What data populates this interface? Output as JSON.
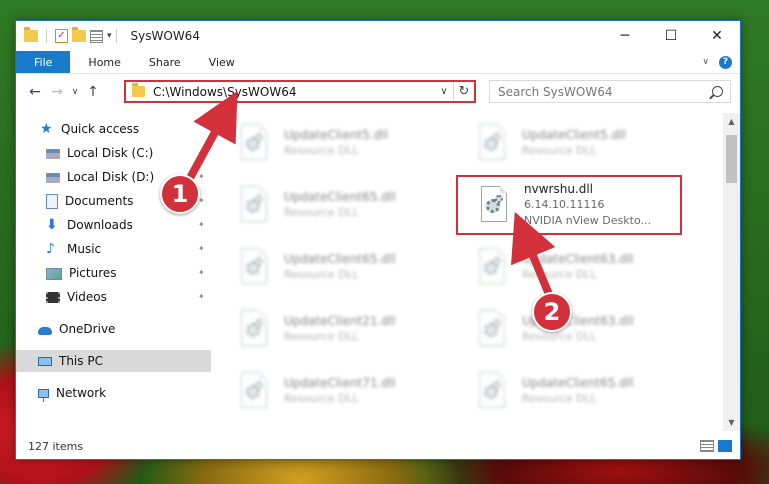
{
  "window": {
    "title": "SysWOW64",
    "minimize_glyph": "─",
    "maximize_glyph": "☐",
    "close_glyph": "✕",
    "qat_dropdown_glyph": "▾"
  },
  "ribbon": {
    "tabs": [
      {
        "label": "File"
      },
      {
        "label": "Home"
      },
      {
        "label": "Share"
      },
      {
        "label": "View"
      }
    ],
    "expand_glyph": "∨",
    "help_glyph": "?"
  },
  "navigation": {
    "back_glyph": "←",
    "forward_glyph": "→",
    "recent_glyph": "∨",
    "up_glyph": "↑"
  },
  "address": {
    "path": "C:\\Windows\\SysWOW64",
    "dropdown_glyph": "∨",
    "refresh_glyph": "↻"
  },
  "search": {
    "placeholder": "Search SysWOW64"
  },
  "sidebar": {
    "items": [
      {
        "label": "Quick access",
        "icon": "star-icon"
      },
      {
        "label": "Local Disk (C:)",
        "icon": "disk-icon",
        "pinned": true
      },
      {
        "label": "Local Disk (D:)",
        "icon": "disk-icon",
        "pinned": true
      },
      {
        "label": "Documents",
        "icon": "document-icon",
        "pinned": true
      },
      {
        "label": "Downloads",
        "icon": "download-icon",
        "pinned": true
      },
      {
        "label": "Music",
        "icon": "music-icon",
        "pinned": true
      },
      {
        "label": "Pictures",
        "icon": "pictures-icon",
        "pinned": true
      },
      {
        "label": "Videos",
        "icon": "videos-icon",
        "pinned": true
      },
      {
        "label": "OneDrive",
        "icon": "onedrive-icon"
      },
      {
        "label": "This PC",
        "icon": "pc-icon",
        "selected": true
      },
      {
        "label": "Network",
        "icon": "network-icon"
      }
    ]
  },
  "files": [
    {
      "name": "UpdateClient5.dll",
      "sub": "Resource DLL"
    },
    {
      "name": "UpdateClient5.dll",
      "sub": "Resource DLL"
    },
    {
      "name": "UpdateClient65.dll",
      "sub": "Resource DLL"
    },
    {
      "name": "nvwrshu.dll",
      "version": "6.14.10.11116",
      "description": "NVIDIA nView Deskto..."
    },
    {
      "name": "UpdateClient65.dll",
      "sub": "Resource DLL"
    },
    {
      "name": "UpdateClient63.dll",
      "sub": "Resource DLL"
    },
    {
      "name": "UpdateClient21.dll",
      "sub": "Resource DLL"
    },
    {
      "name": "UpdateClient63.dll",
      "sub": "Resource DLL"
    },
    {
      "name": "UpdateClient71.dll",
      "sub": "Resource DLL"
    },
    {
      "name": "UpdateClient65.dll",
      "sub": "Resource DLL"
    }
  ],
  "status": {
    "item_count": "127 items"
  },
  "annotations": {
    "callout_1": "1",
    "callout_2": "2",
    "accent_color": "#d2303a"
  },
  "colors": {
    "ribbon_file_tab": "#1979ca",
    "selected_nav": "#d9d9d9"
  }
}
